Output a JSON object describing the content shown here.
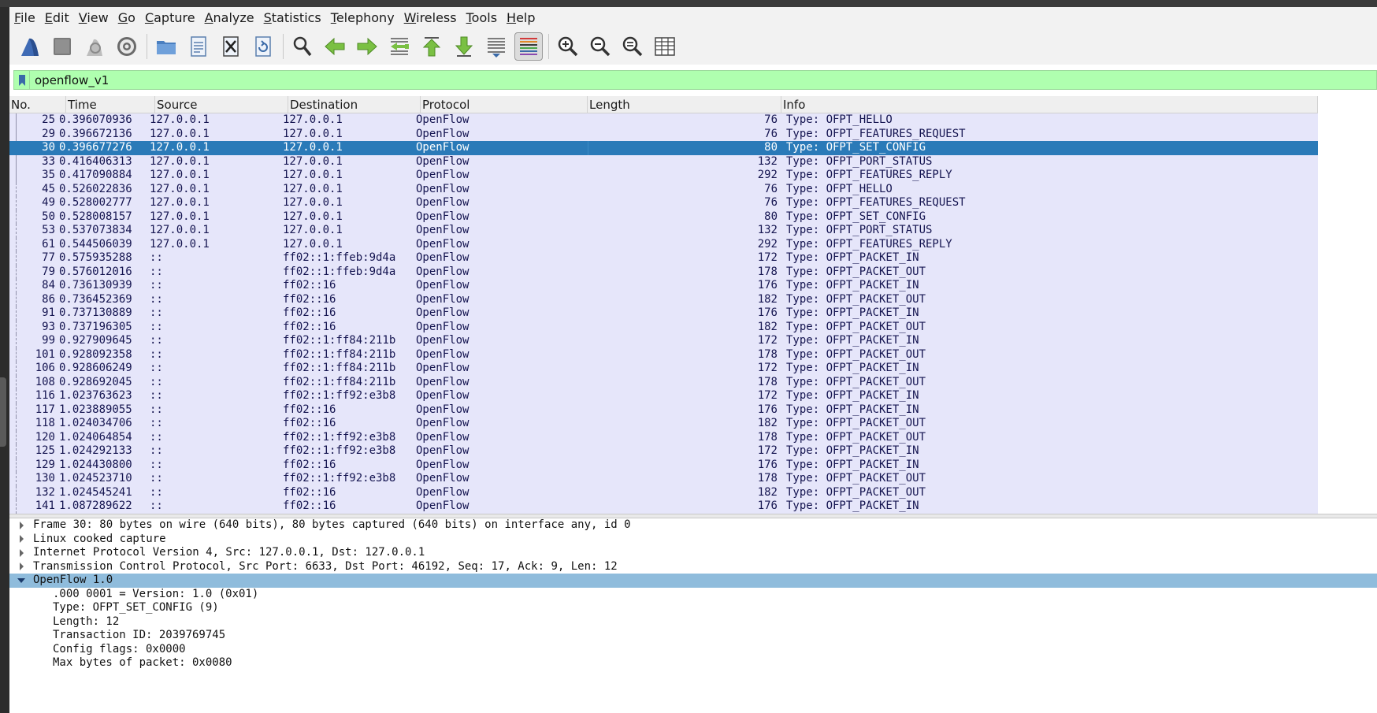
{
  "menu": [
    "File",
    "Edit",
    "View",
    "Go",
    "Capture",
    "Analyze",
    "Statistics",
    "Telephony",
    "Wireless",
    "Tools",
    "Help"
  ],
  "toolbar_icons": [
    "shark-fin-start-icon",
    "stop-square-icon",
    "restart-shark-fin-icon",
    "capture-options-gear-icon",
    "open-folder-icon",
    "save-file-icon",
    "close-file-icon",
    "reload-file-icon",
    "find-packet-icon",
    "go-back-arrow-icon",
    "go-forward-arrow-icon",
    "go-to-packet-icon",
    "go-first-packet-icon",
    "go-last-packet-icon",
    "auto-scroll-icon",
    "colorize-icon",
    "zoom-in-icon",
    "zoom-out-icon",
    "zoom-normal-icon",
    "resize-columns-icon"
  ],
  "filter": {
    "value": "openflow_v1"
  },
  "columns": [
    "No.",
    "Time",
    "Source",
    "Destination",
    "Protocol",
    "Length",
    "Info"
  ],
  "packets": [
    {
      "no": "25",
      "time": "0.396070936",
      "src": "127.0.0.1",
      "dst": "127.0.0.1",
      "proto": "OpenFlow",
      "len": "76",
      "info": "Type: OFPT_HELLO"
    },
    {
      "no": "29",
      "time": "0.396672136",
      "src": "127.0.0.1",
      "dst": "127.0.0.1",
      "proto": "OpenFlow",
      "len": "76",
      "info": "Type: OFPT_FEATURES_REQUEST"
    },
    {
      "no": "30",
      "time": "0.396677276",
      "src": "127.0.0.1",
      "dst": "127.0.0.1",
      "proto": "OpenFlow",
      "len": "80",
      "info": "Type: OFPT_SET_CONFIG",
      "selected": true
    },
    {
      "no": "33",
      "time": "0.416406313",
      "src": "127.0.0.1",
      "dst": "127.0.0.1",
      "proto": "OpenFlow",
      "len": "132",
      "info": "Type: OFPT_PORT_STATUS"
    },
    {
      "no": "35",
      "time": "0.417090884",
      "src": "127.0.0.1",
      "dst": "127.0.0.1",
      "proto": "OpenFlow",
      "len": "292",
      "info": "Type: OFPT_FEATURES_REPLY"
    },
    {
      "no": "45",
      "time": "0.526022836",
      "src": "127.0.0.1",
      "dst": "127.0.0.1",
      "proto": "OpenFlow",
      "len": "76",
      "info": "Type: OFPT_HELLO"
    },
    {
      "no": "49",
      "time": "0.528002777",
      "src": "127.0.0.1",
      "dst": "127.0.0.1",
      "proto": "OpenFlow",
      "len": "76",
      "info": "Type: OFPT_FEATURES_REQUEST"
    },
    {
      "no": "50",
      "time": "0.528008157",
      "src": "127.0.0.1",
      "dst": "127.0.0.1",
      "proto": "OpenFlow",
      "len": "80",
      "info": "Type: OFPT_SET_CONFIG"
    },
    {
      "no": "53",
      "time": "0.537073834",
      "src": "127.0.0.1",
      "dst": "127.0.0.1",
      "proto": "OpenFlow",
      "len": "132",
      "info": "Type: OFPT_PORT_STATUS"
    },
    {
      "no": "61",
      "time": "0.544506039",
      "src": "127.0.0.1",
      "dst": "127.0.0.1",
      "proto": "OpenFlow",
      "len": "292",
      "info": "Type: OFPT_FEATURES_REPLY"
    },
    {
      "no": "77",
      "time": "0.575935288",
      "src": "::",
      "dst": "ff02::1:ffeb:9d4a",
      "proto": "OpenFlow",
      "len": "172",
      "info": "Type: OFPT_PACKET_IN"
    },
    {
      "no": "79",
      "time": "0.576012016",
      "src": "::",
      "dst": "ff02::1:ffeb:9d4a",
      "proto": "OpenFlow",
      "len": "178",
      "info": "Type: OFPT_PACKET_OUT"
    },
    {
      "no": "84",
      "time": "0.736130939",
      "src": "::",
      "dst": "ff02::16",
      "proto": "OpenFlow",
      "len": "176",
      "info": "Type: OFPT_PACKET_IN"
    },
    {
      "no": "86",
      "time": "0.736452369",
      "src": "::",
      "dst": "ff02::16",
      "proto": "OpenFlow",
      "len": "182",
      "info": "Type: OFPT_PACKET_OUT"
    },
    {
      "no": "91",
      "time": "0.737130889",
      "src": "::",
      "dst": "ff02::16",
      "proto": "OpenFlow",
      "len": "176",
      "info": "Type: OFPT_PACKET_IN"
    },
    {
      "no": "93",
      "time": "0.737196305",
      "src": "::",
      "dst": "ff02::16",
      "proto": "OpenFlow",
      "len": "182",
      "info": "Type: OFPT_PACKET_OUT"
    },
    {
      "no": "99",
      "time": "0.927909645",
      "src": "::",
      "dst": "ff02::1:ff84:211b",
      "proto": "OpenFlow",
      "len": "172",
      "info": "Type: OFPT_PACKET_IN"
    },
    {
      "no": "101",
      "time": "0.928092358",
      "src": "::",
      "dst": "ff02::1:ff84:211b",
      "proto": "OpenFlow",
      "len": "178",
      "info": "Type: OFPT_PACKET_OUT"
    },
    {
      "no": "106",
      "time": "0.928606249",
      "src": "::",
      "dst": "ff02::1:ff84:211b",
      "proto": "OpenFlow",
      "len": "172",
      "info": "Type: OFPT_PACKET_IN"
    },
    {
      "no": "108",
      "time": "0.928692045",
      "src": "::",
      "dst": "ff02::1:ff84:211b",
      "proto": "OpenFlow",
      "len": "178",
      "info": "Type: OFPT_PACKET_OUT"
    },
    {
      "no": "116",
      "time": "1.023763623",
      "src": "::",
      "dst": "ff02::1:ff92:e3b8",
      "proto": "OpenFlow",
      "len": "172",
      "info": "Type: OFPT_PACKET_IN"
    },
    {
      "no": "117",
      "time": "1.023889055",
      "src": "::",
      "dst": "ff02::16",
      "proto": "OpenFlow",
      "len": "176",
      "info": "Type: OFPT_PACKET_IN"
    },
    {
      "no": "118",
      "time": "1.024034706",
      "src": "::",
      "dst": "ff02::16",
      "proto": "OpenFlow",
      "len": "182",
      "info": "Type: OFPT_PACKET_OUT"
    },
    {
      "no": "120",
      "time": "1.024064854",
      "src": "::",
      "dst": "ff02::1:ff92:e3b8",
      "proto": "OpenFlow",
      "len": "178",
      "info": "Type: OFPT_PACKET_OUT"
    },
    {
      "no": "125",
      "time": "1.024292133",
      "src": "::",
      "dst": "ff02::1:ff92:e3b8",
      "proto": "OpenFlow",
      "len": "172",
      "info": "Type: OFPT_PACKET_IN"
    },
    {
      "no": "129",
      "time": "1.024430800",
      "src": "::",
      "dst": "ff02::16",
      "proto": "OpenFlow",
      "len": "176",
      "info": "Type: OFPT_PACKET_IN"
    },
    {
      "no": "130",
      "time": "1.024523710",
      "src": "::",
      "dst": "ff02::1:ff92:e3b8",
      "proto": "OpenFlow",
      "len": "178",
      "info": "Type: OFPT_PACKET_OUT"
    },
    {
      "no": "132",
      "time": "1.024545241",
      "src": "::",
      "dst": "ff02::16",
      "proto": "OpenFlow",
      "len": "182",
      "info": "Type: OFPT_PACKET_OUT"
    },
    {
      "no": "141",
      "time": "1.087289622",
      "src": "::",
      "dst": "ff02::16",
      "proto": "OpenFlow",
      "len": "176",
      "info": "Type: OFPT_PACKET_IN"
    }
  ],
  "details": [
    {
      "text": "Frame 30: 80 bytes on wire (640 bits), 80 bytes captured (640 bits) on interface any, id 0",
      "expanded": false
    },
    {
      "text": "Linux cooked capture",
      "expanded": false
    },
    {
      "text": "Internet Protocol Version 4, Src: 127.0.0.1, Dst: 127.0.0.1",
      "expanded": false
    },
    {
      "text": "Transmission Control Protocol, Src Port: 6633, Dst Port: 46192, Seq: 17, Ack: 9, Len: 12",
      "expanded": false
    },
    {
      "text": "OpenFlow 1.0",
      "expanded": true,
      "selected": true,
      "children": [
        ".000 0001 = Version: 1.0 (0x01)",
        "Type: OFPT_SET_CONFIG (9)",
        "Length: 12",
        "Transaction ID: 2039769745",
        "Config flags: 0x0000",
        "Max bytes of packet: 0x0080"
      ]
    }
  ],
  "colors": {
    "row_bg": "#e6e6fa",
    "row_fg": "#141450",
    "selected_bg": "#2a7ab8",
    "filter_bg": "#afffaf",
    "detail_selected_bg": "#8fbcdc"
  }
}
